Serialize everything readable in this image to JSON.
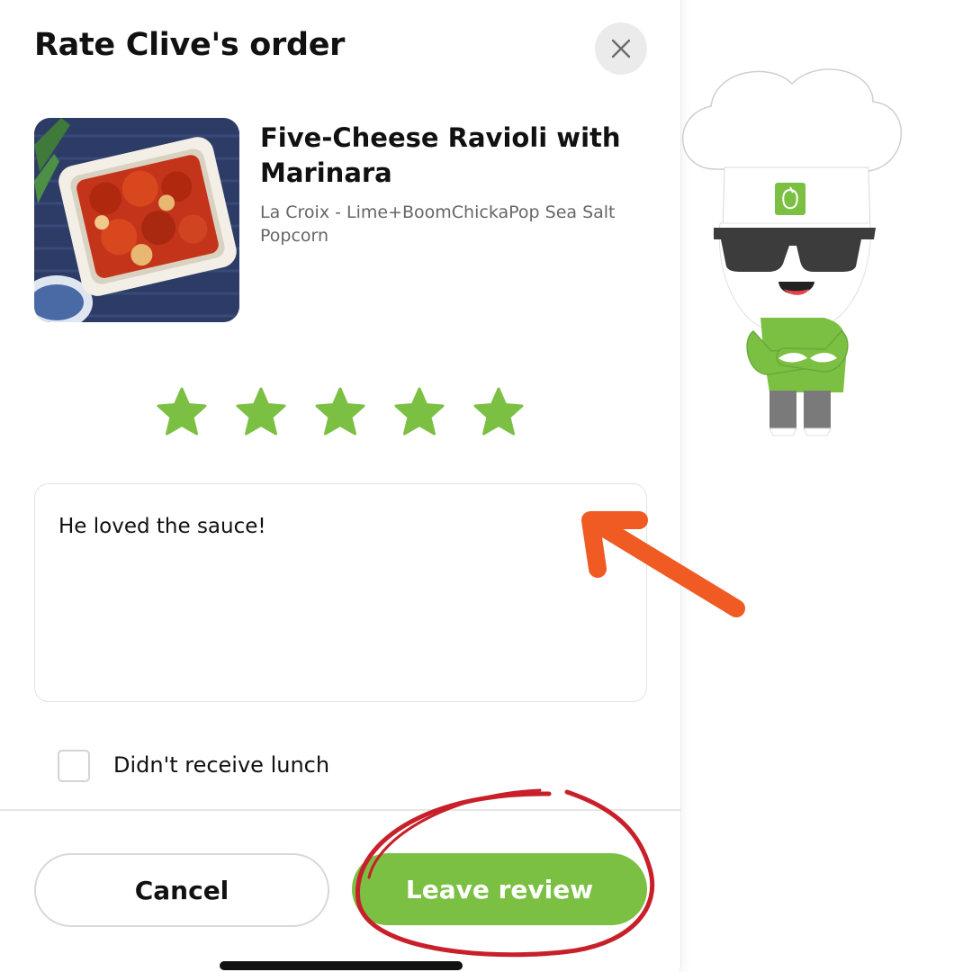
{
  "modal": {
    "title": "Rate Clive's order",
    "close_icon": "close-icon"
  },
  "item": {
    "name": "Five-Cheese Ravioli with Marinara",
    "sides": "La Croix - Lime+BoomChickaPop Sea Salt Popcorn",
    "image": "ravioli-tray-photo"
  },
  "rating": {
    "value": 5,
    "max": 5,
    "star_color": "#7bc043"
  },
  "review": {
    "text": "He loved the sauce!"
  },
  "not_received": {
    "label": "Didn't receive lunch",
    "checked": false
  },
  "actions": {
    "cancel_label": "Cancel",
    "submit_label": "Leave review"
  },
  "annotations": {
    "arrow_color": "#f05a23",
    "circle_color": "#c8202a"
  },
  "mascot": {
    "name": "chef-mascot-icon",
    "shirt_color": "#7bc043"
  }
}
